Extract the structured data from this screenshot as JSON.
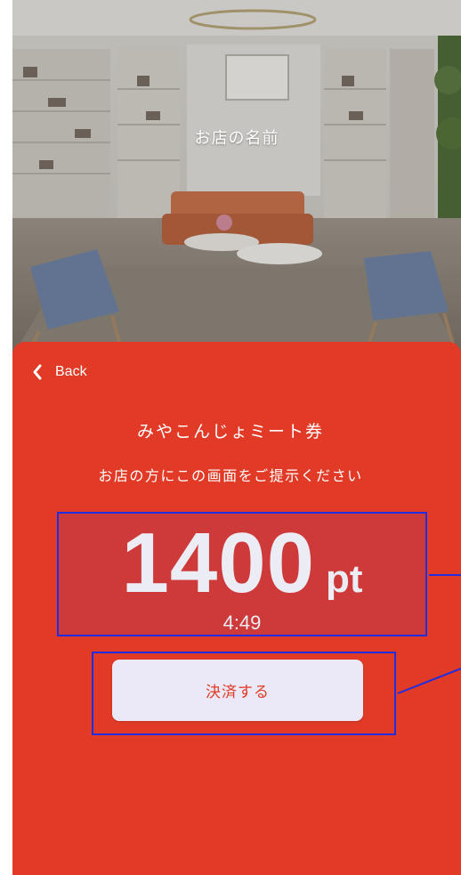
{
  "store": {
    "name": "お店の名前"
  },
  "nav": {
    "back_label": "Back"
  },
  "coupon": {
    "title": "みやこんじょミート券",
    "instruction": "お店の方にこの画面をご提示ください",
    "points_value": "1400",
    "points_unit": "pt",
    "timer": "4:49"
  },
  "actions": {
    "pay_label": "決済する"
  },
  "colors": {
    "sheet_background": "#e13a26",
    "points_box": "#cd3a39",
    "annotation_outline": "#1f2ee0",
    "pay_button_background": "#ebe9f7"
  }
}
